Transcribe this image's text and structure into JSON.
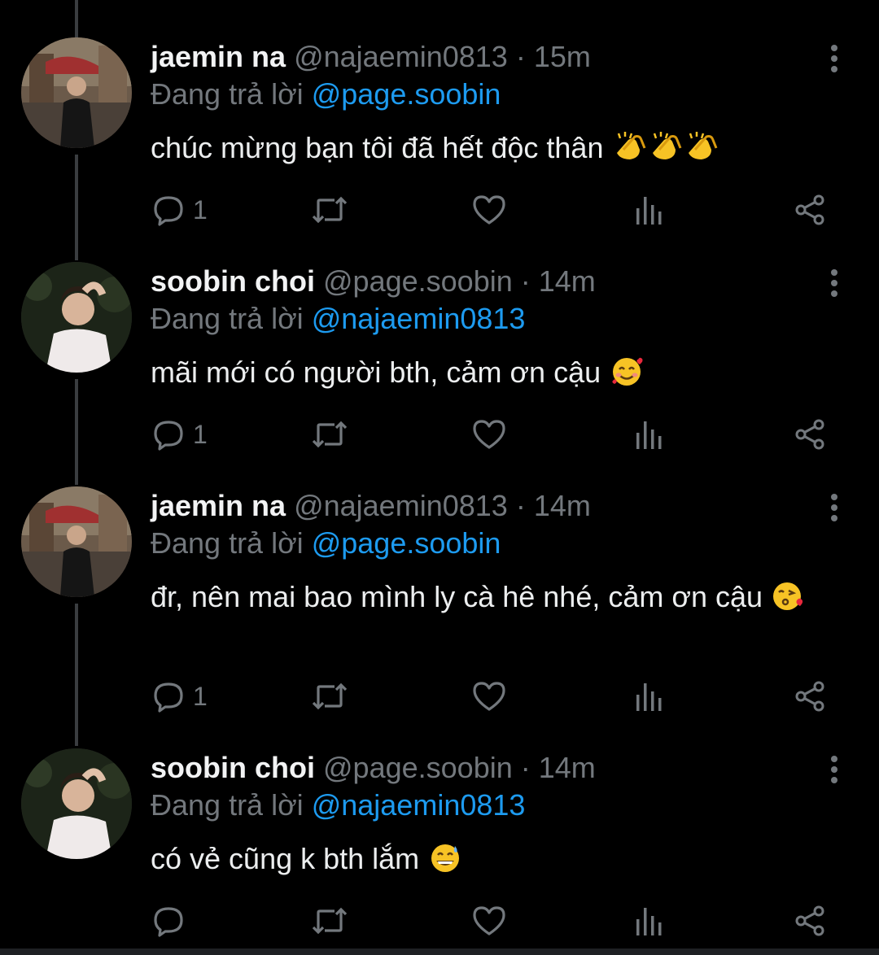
{
  "colors": {
    "background": "#000000",
    "name": "#f2f3f4",
    "muted": "#73787d",
    "mention": "#1d9bf0",
    "thread_line": "#3a3d40"
  },
  "tweets": [
    {
      "name": "jaemin na",
      "handle": "@najaemin0813",
      "dot": "·",
      "time": "15m",
      "replying_prefix": "Đang trả lời",
      "replying_to": "@page.soobin",
      "text": "chúc mừng bạn tôi đã hết độc thân",
      "emoji": [
        "clapping-hands-emoji",
        "clapping-hands-emoji",
        "clapping-hands-emoji"
      ],
      "reply_count": "1",
      "avatar": "jaemin-avatar"
    },
    {
      "name": "soobin choi",
      "handle": "@page.soobin",
      "dot": "·",
      "time": "14m",
      "replying_prefix": "Đang trả lời",
      "replying_to": "@najaemin0813",
      "text": "mãi mới có người bth, cảm ơn cậu",
      "emoji": [
        "smiling-face-with-hearts-emoji"
      ],
      "reply_count": "1",
      "avatar": "soobin-avatar"
    },
    {
      "name": "jaemin na",
      "handle": "@najaemin0813",
      "dot": "·",
      "time": "14m",
      "replying_prefix": "Đang trả lời",
      "replying_to": "@page.soobin",
      "text": "đr, nên mai bao mình ly cà hê nhé, cảm ơn cậu",
      "emoji": [
        "face-blowing-kiss-emoji"
      ],
      "reply_count": "1",
      "avatar": "jaemin-avatar"
    },
    {
      "name": "soobin choi",
      "handle": "@page.soobin",
      "dot": "·",
      "time": "14m",
      "replying_prefix": "Đang trả lời",
      "replying_to": "@najaemin0813",
      "text": "có vẻ cũng k bth lắm",
      "emoji": [
        "grinning-face-with-sweat-emoji"
      ],
      "reply_count": "",
      "avatar": "soobin-avatar"
    }
  ]
}
